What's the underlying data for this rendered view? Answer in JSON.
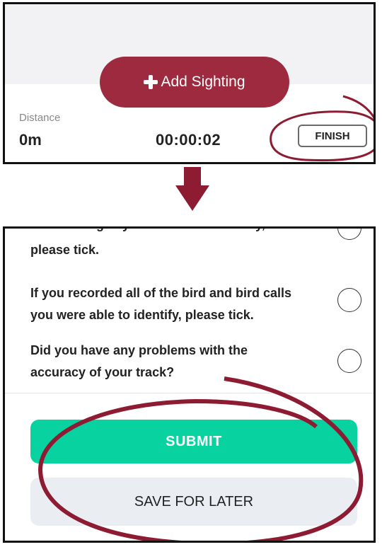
{
  "tracking": {
    "add_sighting_label": "Add Sighting",
    "distance_label": "Distance",
    "distance_value": "0m",
    "timer_value": "00:00:02",
    "finish_label": "FINISH"
  },
  "survey": {
    "clipped_text_top": "mammal signs you encountered today,",
    "clipped_text_line": "please tick.",
    "questions": [
      {
        "line1": "If you recorded all of the bird and bird calls",
        "line2": "you were able to identify, please tick."
      },
      {
        "line1": "Did you have any problems with the",
        "line2": "accuracy of your track?"
      }
    ],
    "submit_label": "SUBMIT",
    "save_label": "SAVE FOR LATER"
  },
  "colors": {
    "brand_red": "#9e2a3f",
    "annotation_red": "#8d1c33",
    "submit_green": "#08d2a0"
  },
  "icons": {
    "add": "plus-icon",
    "arrow": "arrow-down-icon"
  }
}
